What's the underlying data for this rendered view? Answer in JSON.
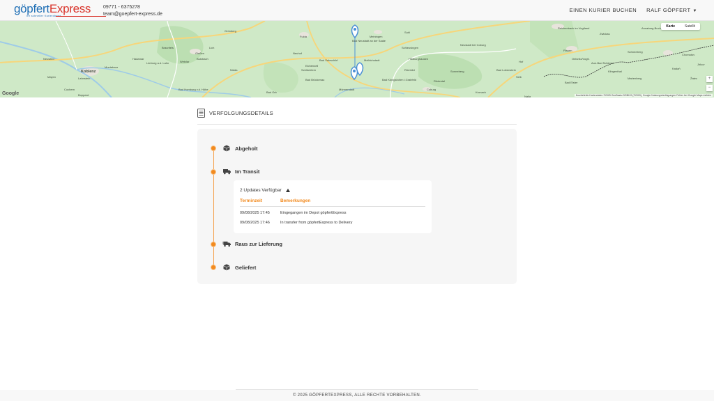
{
  "header": {
    "logo": {
      "part1": "göpfert",
      "part2": "Express",
      "tagline": "Ihr schneller Kurierdienst"
    },
    "phone": "09771 - 6375278",
    "email": "team@goepfert-express.de",
    "nav": {
      "book_courier": "EINEN KURIER BUCHEN",
      "user": "RALF GÖPFERT",
      "user_caret": "▼"
    }
  },
  "map": {
    "type_buttons": [
      "Karte",
      "Satellit"
    ],
    "active_type": "Karte",
    "google": "Google",
    "footer_text": "Kurzbefehle   Kartendaten ©2025 GeoBasis-DE/BKG (©2009), Google   Nutzungsbedingungen   Fehler bei Google Maps melden",
    "zoom_in": "+",
    "zoom_out": "−",
    "places": [
      "Koblenz",
      "Montabaur",
      "Limburg a.d. Lahn",
      "Bad Homburg v.d. Höhe",
      "Fulda",
      "Gießen",
      "Schlüchtern",
      "Bad Brückenau",
      "Meiningen",
      "Suhl",
      "Schleusingen",
      "Hildburghausen",
      "Römhild",
      "Bad Königshofen i.Grabfeld",
      "Münnerstadt",
      "Mellrichstadt",
      "Coburg",
      "Rödental",
      "Sonneberg",
      "Kronach",
      "Plauen",
      "Reichenbach im Vogtland",
      "Zwickau",
      "Aue-Bad Schlema",
      "Oelsnitz/Vogtl.",
      "Chomutov",
      "Kadaň",
      "Žatec",
      "Selb",
      "Hof",
      "Bad Elster",
      "Neuwied",
      "Mayen",
      "Cochem",
      "Lahnstein",
      "Boppard",
      "Hadamar",
      "Braunfels",
      "Wetzlar",
      "Butzbach",
      "Nidda",
      "Grünberg",
      "Lich",
      "Neuhof",
      "Eichenzell",
      "Bad Orb",
      "Bad Salzschlirf",
      "Bad Lobenstein",
      "Naila",
      "Schneeberg",
      "Annaberg-Buchholz",
      "Jirkov",
      "Klingenthal",
      "Marienberg",
      "Bad Neustadt an der Saale",
      "Neustadt bei Coburg"
    ]
  },
  "tracking": {
    "title": "VERFOLGUNGSDETAILS",
    "steps": [
      {
        "label": "Abgeholt",
        "icon": "package-icon"
      },
      {
        "label": "Im Transit",
        "icon": "truck-icon"
      },
      {
        "label": "Raus zur Lieferung",
        "icon": "delivery-truck-icon"
      },
      {
        "label": "Geliefert",
        "icon": "package-icon"
      }
    ],
    "updates": {
      "toggle_label": "2 Updates Verfügbar",
      "columns": [
        "Terminzeit",
        "Bemerkungen"
      ],
      "rows": [
        {
          "time": "09/08/2025 17:45",
          "remark": "Eingegangen im Depot göpfertExpress"
        },
        {
          "time": "09/08/2025 17:46",
          "remark": "In transfer from göpfertExpress to Delivery"
        }
      ]
    }
  },
  "footer": {
    "copyright": "© 2025 GÖPFERTEXPRESS, ALLE RECHTE VORBEHALTEN."
  },
  "colors": {
    "accent": "#f28a1e",
    "brand_blue": "#1f6fb5",
    "brand_red": "#d9342b",
    "map_land": "#cfe9c7"
  }
}
